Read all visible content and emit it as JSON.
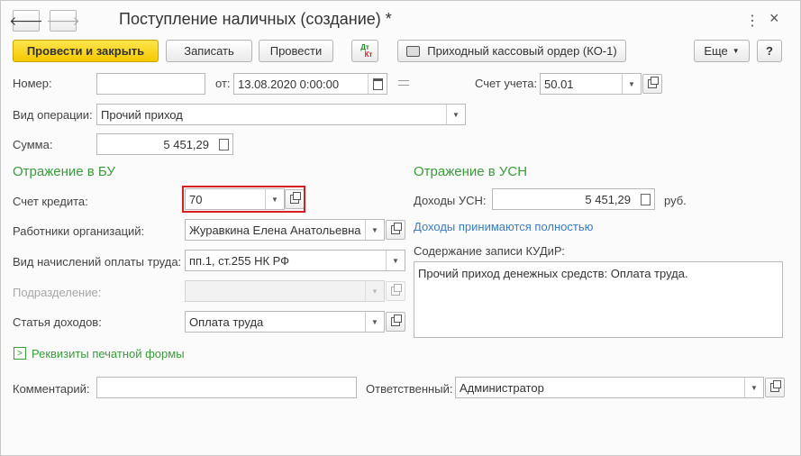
{
  "window": {
    "title": "Поступление наличных (создание) *",
    "menu_icon": "⋮",
    "close_icon": "×"
  },
  "toolbar": {
    "post_close": "Провести и закрыть",
    "save": "Записать",
    "post": "Провести",
    "dtkt_dt": "Дт",
    "dtkt_kt": "Кт",
    "print": "Приходный кассовый ордер (КО-1)",
    "more": "Еще",
    "help": "?"
  },
  "header": {
    "number_label": "Номер:",
    "number_value": "",
    "date_label": "от:",
    "date_value": "13.08.2020  0:00:00",
    "account_label": "Счет учета:",
    "account_value": "50.01",
    "op_label": "Вид операции:",
    "op_value": "Прочий приход",
    "sum_label": "Сумма:",
    "sum_value": "5 451,29"
  },
  "bu": {
    "title": "Отражение в БУ",
    "credit_label": "Счет кредита:",
    "credit_value": "70",
    "employee_label": "Работники организаций:",
    "employee_value": "Журавкина Елена Анатольевна",
    "accrual_label": "Вид начислений оплаты труда:",
    "accrual_value": "пп.1, ст.255 НК РФ",
    "division_label": "Подразделение:",
    "division_value": "",
    "income_label": "Статья доходов:",
    "income_value": "Оплата труда"
  },
  "usn": {
    "title": "Отражение в УСН",
    "income_label": "Доходы УСН:",
    "income_value": "5 451,29",
    "currency": "руб.",
    "link": "Доходы принимаются полностью",
    "kudir_label": "Содержание записи КУДиР:",
    "kudir_value": "Прочий приход денежных средств: Оплата труда."
  },
  "print_form": {
    "label": "Реквизиты печатной формы"
  },
  "footer": {
    "comment_label": "Комментарий:",
    "comment_value": "",
    "responsible_label": "Ответственный:",
    "responsible_value": "Администратор"
  },
  "colors": {
    "primary_button": "#f5c800",
    "section_title": "#3a9a3a",
    "link": "#3a7cc0",
    "highlight": "#d42020"
  }
}
